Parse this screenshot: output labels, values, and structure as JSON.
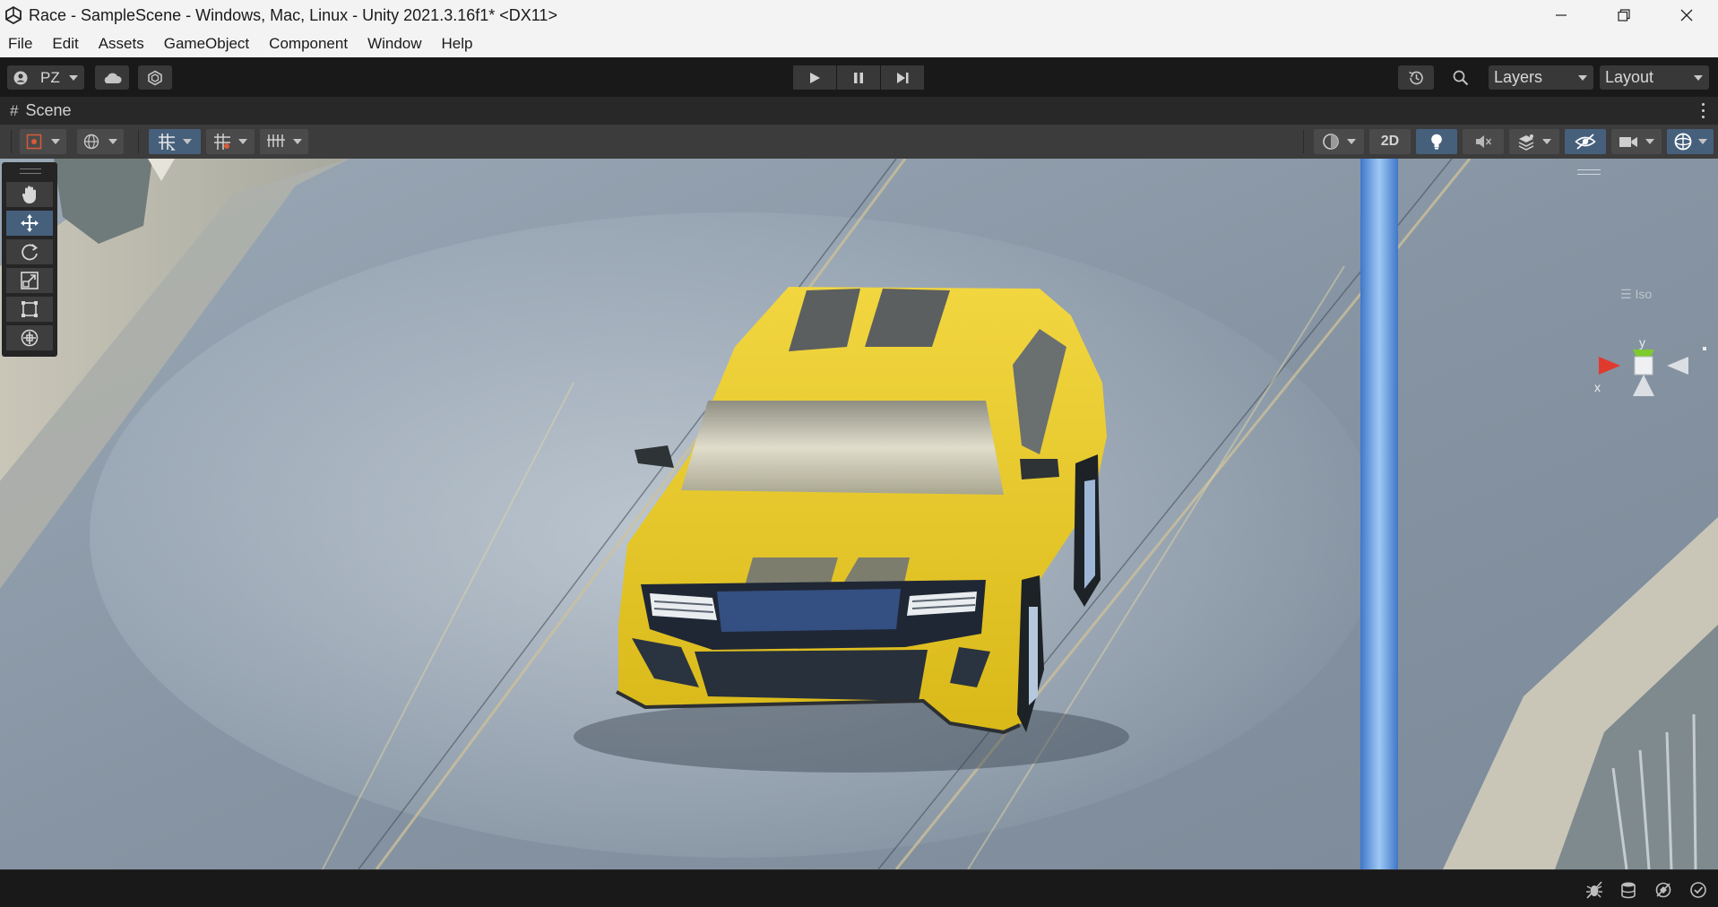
{
  "window": {
    "title": "Race - SampleScene - Windows, Mac, Linux - Unity 2021.3.16f1* <DX11>",
    "app_icon": "unity-logo-icon",
    "controls": [
      "minimize-icon",
      "restore-icon",
      "close-icon"
    ]
  },
  "menubar": {
    "items": [
      "File",
      "Edit",
      "Assets",
      "GameObject",
      "Component",
      "Window",
      "Help"
    ]
  },
  "toolbar": {
    "account_label": "PZ",
    "layers_label": "Layers",
    "layout_label": "Layout",
    "play_controls": [
      "play-icon",
      "pause-icon",
      "step-icon"
    ]
  },
  "scene_view": {
    "tab_label": "Scene",
    "tab_icon": "#",
    "toggle_2d_label": "2D",
    "gizmo": {
      "x_label": "x",
      "y_label": "y",
      "projection_label": "Iso"
    }
  },
  "tools": [
    "hand-tool",
    "move-tool",
    "rotate-tool",
    "scale-tool",
    "rect-tool",
    "transform-tool"
  ],
  "active_tool": "move-tool",
  "colors": {
    "accent_active": "#46607c",
    "car_body": "#f2d52a",
    "gizmo_x": "#e03a2f",
    "gizmo_y": "#7dcb2c"
  }
}
